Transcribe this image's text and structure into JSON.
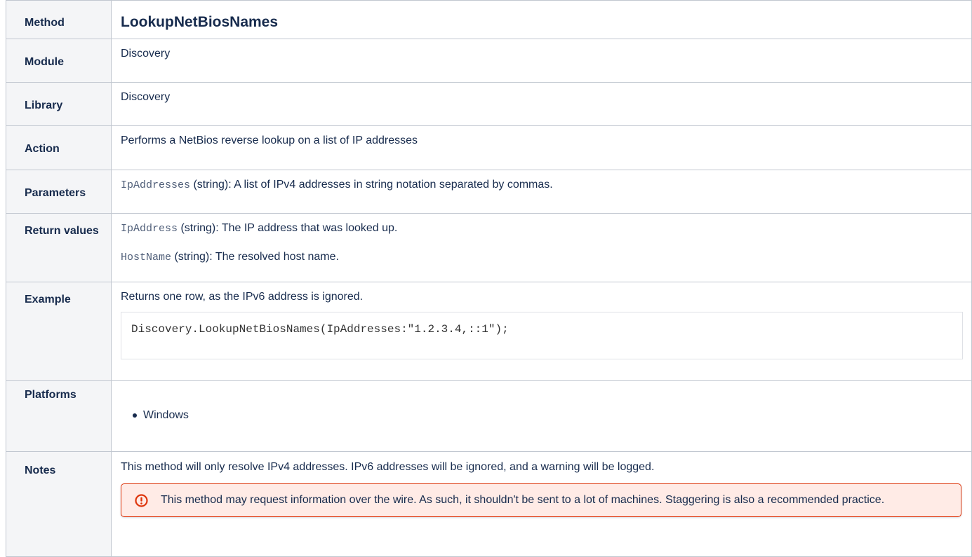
{
  "method": {
    "label": "Method",
    "value": "LookupNetBiosNames"
  },
  "module": {
    "label": "Module",
    "value": "Discovery"
  },
  "library": {
    "label": "Library",
    "value": "Discovery"
  },
  "action": {
    "label": "Action",
    "value": "Performs a NetBios reverse lookup on a list of IP addresses"
  },
  "parameters": {
    "label": "Parameters",
    "param_name": "IpAddresses",
    "param_desc": " (string): A list of IPv4 addresses in string notation separated by commas."
  },
  "return_values": {
    "label": "Return values",
    "items": [
      {
        "name": "IpAddress",
        "desc": " (string): The IP address that was looked up."
      },
      {
        "name": "HostName",
        "desc": " (string): The resolved host name."
      }
    ]
  },
  "example": {
    "label": "Example",
    "intro": "Returns one row, as the IPv6 address is ignored.",
    "code": "Discovery.LookupNetBiosNames(IpAddresses:\"1.2.3.4,::1\");"
  },
  "platforms": {
    "label": "Platforms",
    "items": [
      "Windows"
    ]
  },
  "notes": {
    "label": "Notes",
    "text": "This method will only resolve IPv4 addresses. IPv6 addresses will be ignored, and a warning will be logged.",
    "warning": "This method may request information over the wire. As such, it shouldn't be sent to a lot of machines. Staggering is also a recommended practice.",
    "warning_icon": "error-circle-icon",
    "warning_color": "#de350b"
  }
}
